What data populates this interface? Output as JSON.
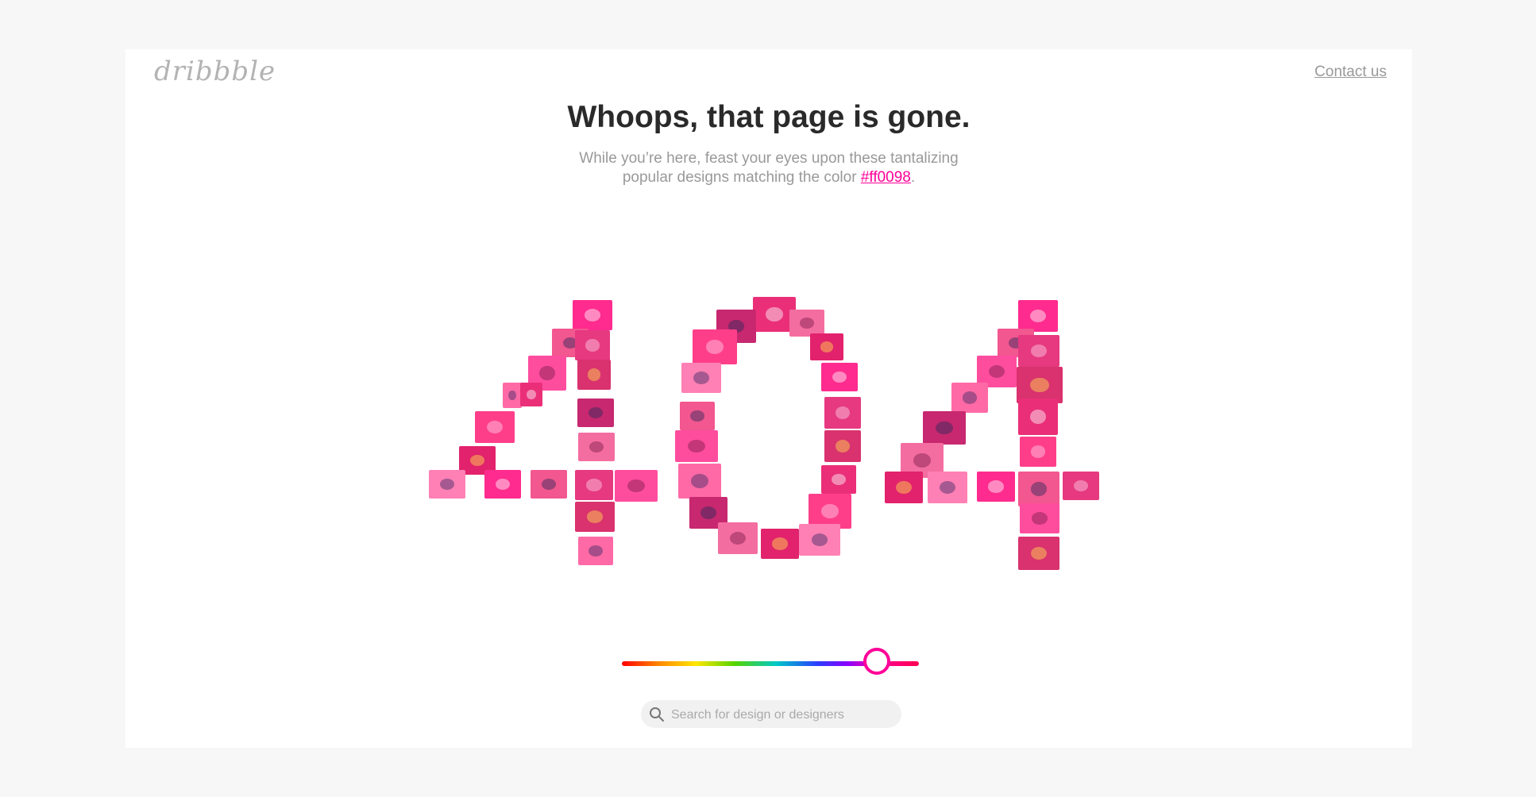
{
  "logo": {
    "text": "dribbble"
  },
  "header": {
    "contact_label": "Contact us"
  },
  "main": {
    "title": "Whoops, that page is gone.",
    "subtitle_line1": "While you’re here, feast your eyes upon these tantalizing",
    "subtitle_line2_prefix": "popular designs matching the color",
    "color_link": "#ff0098",
    "subtitle_line2_suffix": "."
  },
  "shots": {
    "label": "404",
    "count": 66
  },
  "color_slider": {
    "value_fraction": 0.85,
    "selected_color": "#ff0098"
  },
  "search": {
    "placeholder": "Search for design or designers",
    "value": ""
  },
  "colors": {
    "accent": "#ff0098",
    "title": "#2a2a2a",
    "muted": "#999999",
    "page_bg": "#ffffff",
    "outer_bg": "#f7f7f7"
  }
}
